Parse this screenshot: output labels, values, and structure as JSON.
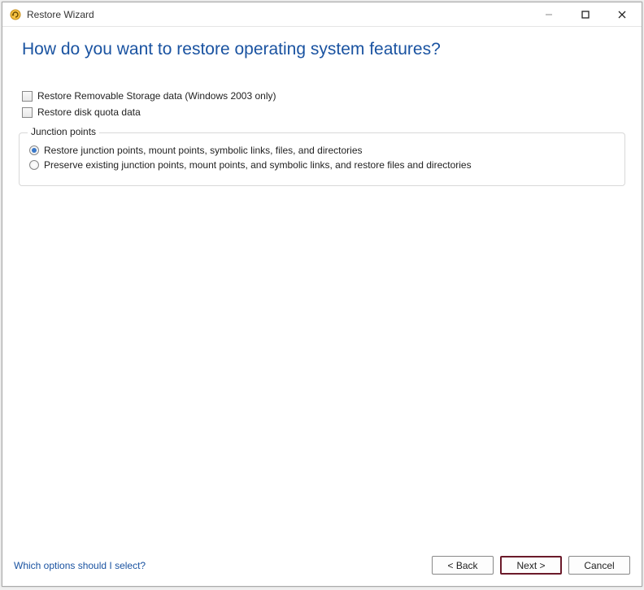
{
  "title": "Restore Wizard",
  "page_title": "How do you want to restore operating system features?",
  "checks": {
    "removable": "Restore Removable Storage data (Windows 2003 only)",
    "diskquota": "Restore disk quota data"
  },
  "junction": {
    "legend": "Junction points",
    "opt1": "Restore junction points, mount points, symbolic links, files, and directories",
    "opt2": "Preserve existing junction points, mount points, and symbolic links, and restore files and directories"
  },
  "help_link": "Which options should I select?",
  "buttons": {
    "back": "< Back",
    "next": "Next >",
    "cancel": "Cancel"
  }
}
